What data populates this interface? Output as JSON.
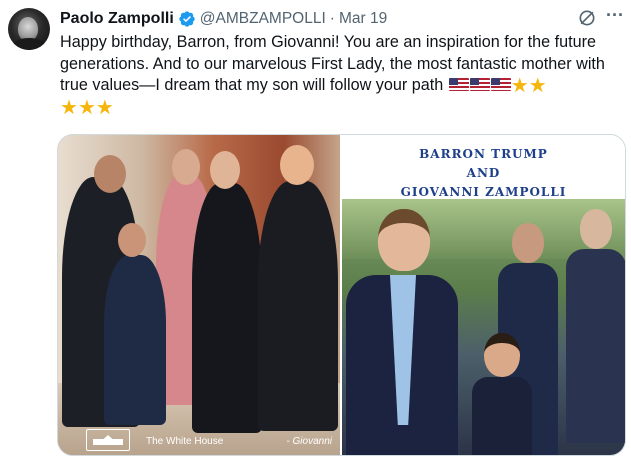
{
  "author": {
    "name": "Paolo Zampolli",
    "handle": "@AMBZAMPOLLI",
    "separator": "·",
    "date": "Mar 19",
    "verified_icon": "verified-badge-icon"
  },
  "actions": {
    "grok_icon": "grok-icon",
    "more_icon": "more-options-icon",
    "more_label": "···"
  },
  "tweet": {
    "text": "Happy birthday, Barron, from Giovanni! You are an inspiration for the future generations. And to our marvelous First Lady, the most fantastic mother with true values—I dream that  my son will follow your path",
    "emojis": [
      "us-flag",
      "us-flag",
      "us-flag",
      "star",
      "star",
      "star",
      "star",
      "star"
    ]
  },
  "media": {
    "left_photo": {
      "caption_left": "The White House",
      "caption_right": "- Giovanni"
    },
    "right_photo": {
      "title_line1": "BARRON TRUMP",
      "title_line2": "AND",
      "title_line3": "GIOVANNI ZAMPOLLI"
    }
  },
  "colors": {
    "verified_blue": "#1d9bf0",
    "secondary_text": "#536471",
    "title_blue": "#1e3f8a",
    "star": "#f5b50a"
  }
}
